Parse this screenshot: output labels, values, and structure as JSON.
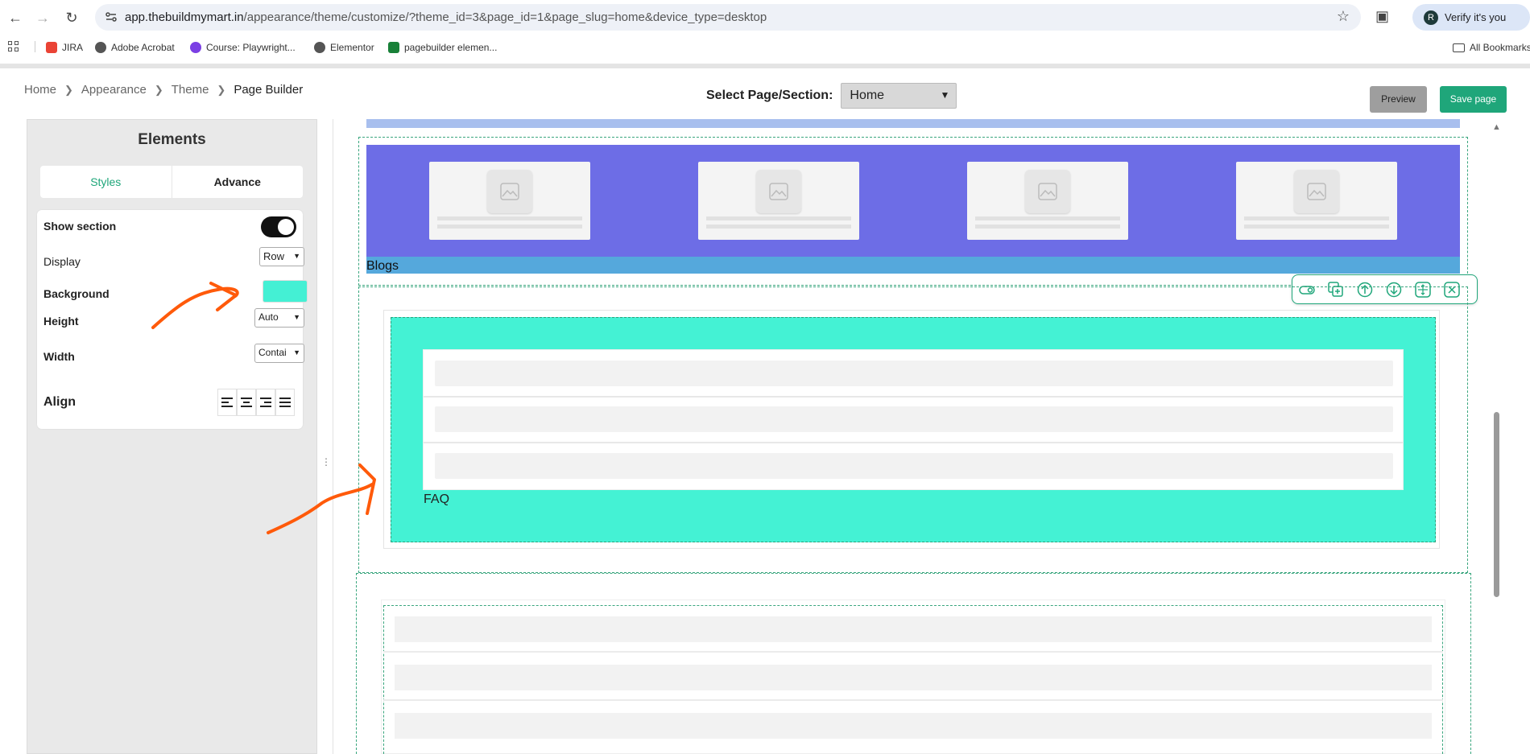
{
  "browser": {
    "url_host": "app.thebuildmymart.in",
    "url_path": "/appearance/theme/customize/?theme_id=3&page_id=1&page_slug=home&device_type=desktop",
    "profile_label": "Verify it's you",
    "profile_initial": "R",
    "bookmarks": [
      {
        "label": "JIRA",
        "color": "#ea4335"
      },
      {
        "label": "Adobe Acrobat",
        "color": "#555555"
      },
      {
        "label": "Course: Playwright...",
        "color": "#7b3fe4"
      },
      {
        "label": "Elementor",
        "color": "#555555"
      },
      {
        "label": "pagebuilder elemen...",
        "color": "#188038"
      }
    ],
    "all_bookmarks": "All Bookmarks"
  },
  "breadcrumb": [
    "Home",
    "Appearance",
    "Theme",
    "Page Builder"
  ],
  "header": {
    "select_label": "Select Page/Section:",
    "select_value": "Home",
    "preview_label": "Preview",
    "save_label": "Save page"
  },
  "panel": {
    "title": "Elements",
    "tab_styles": "Styles",
    "tab_advance": "Advance",
    "show_section_label": "Show section",
    "show_section_on": true,
    "display_label": "Display",
    "display_value": "Row",
    "background_label": "Background",
    "background_color": "#44f0d4",
    "height_label": "Height",
    "height_value": "Auto",
    "width_label": "Width",
    "width_value": "Contai",
    "align_label": "Align",
    "align_options": [
      "align-left-icon",
      "align-center-icon",
      "align-right-icon",
      "align-justify-icon"
    ]
  },
  "canvas": {
    "blogs_label": "Blogs",
    "blogs_bg": "#6d6de6",
    "blog_cards": 4,
    "faq_label": "FAQ",
    "faq_bg": "#44f2d4",
    "faq_items": 3,
    "lower_items": 3,
    "section_toolbar": [
      "toggle-visibility-icon",
      "duplicate-icon",
      "move-up-icon",
      "move-down-icon",
      "drag-move-icon",
      "delete-icon"
    ]
  },
  "annotation_color": "#ff5a0a"
}
